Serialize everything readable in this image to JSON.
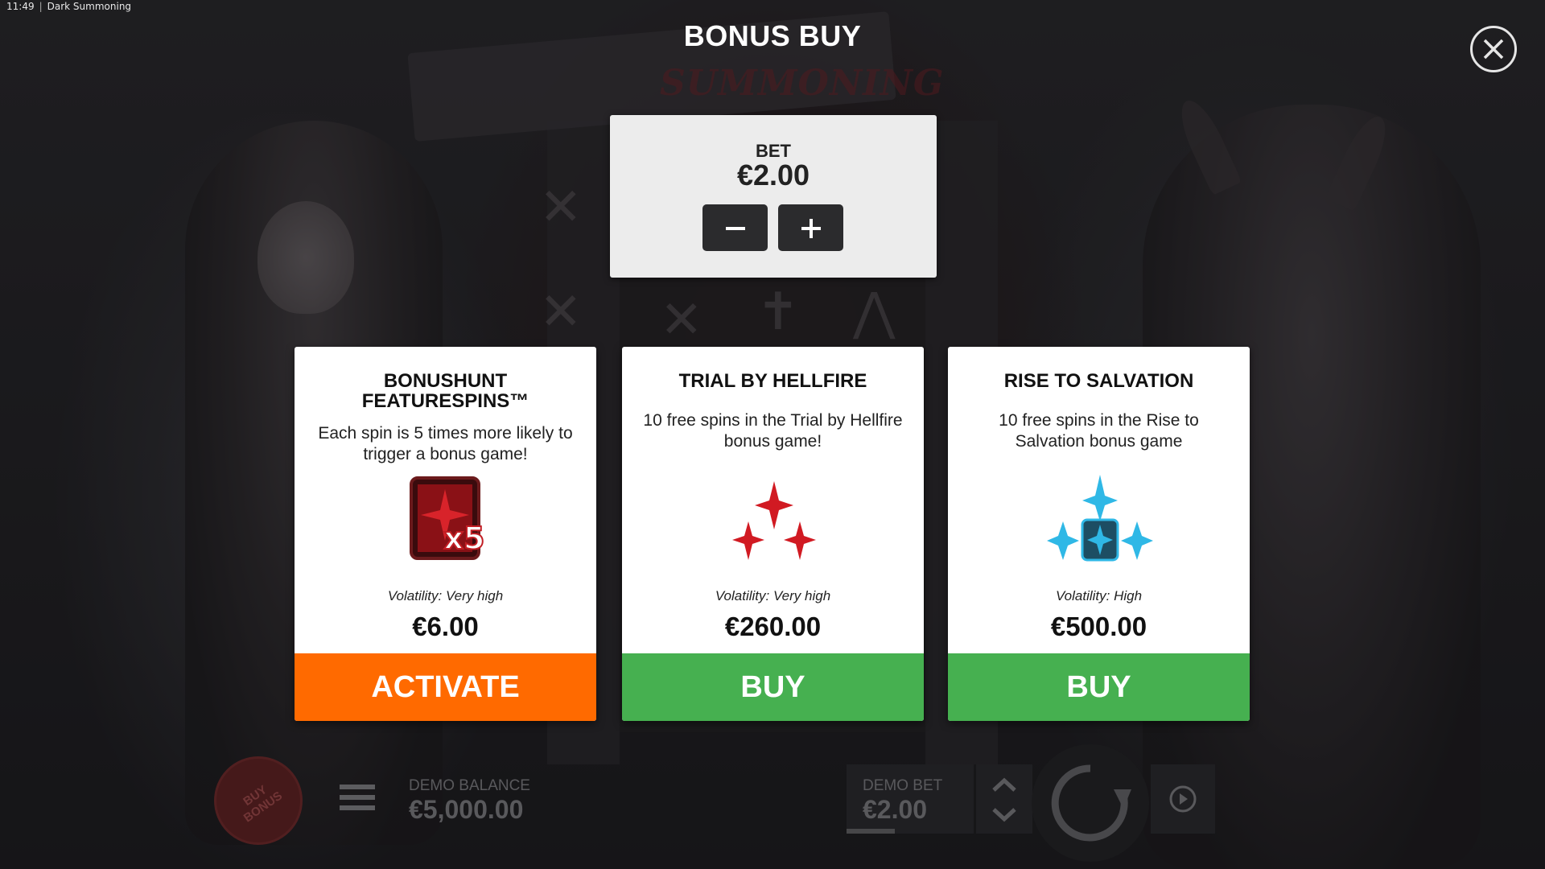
{
  "system": {
    "time": "11:49",
    "app_title": "Dark Summoning"
  },
  "background": {
    "logo_text": "SUMMONING"
  },
  "modal": {
    "title": "BONUS BUY",
    "close_icon": "close-icon"
  },
  "bet": {
    "label": "BET",
    "value": "€2.00",
    "decrease_icon": "minus-icon",
    "increase_icon": "plus-icon"
  },
  "cards": [
    {
      "title": "BONUSHUNT FEATURESPINS™",
      "description": "Each spin is 5 times more likely to trigger a bonus game!",
      "icon": "x5-multiplier-icon",
      "icon_text": "x5",
      "volatility": "Volatility: Very high",
      "price": "€6.00",
      "action": "ACTIVATE",
      "action_color": "#ff6a00"
    },
    {
      "title": "TRIAL BY HELLFIRE",
      "description": "10 free spins in the Trial by Hellfire bonus game!",
      "icon": "red-crosses-icon",
      "volatility": "Volatility: Very high",
      "price": "€260.00",
      "action": "BUY",
      "action_color": "#46b050"
    },
    {
      "title": "RISE TO SALVATION",
      "description": "10 free spins in the Rise to Salvation bonus game",
      "icon": "blue-crosses-icon",
      "volatility": "Volatility: High",
      "price": "€500.00",
      "action": "BUY",
      "action_color": "#46b050"
    }
  ],
  "hud": {
    "buy_bonus": "BUY BONUS",
    "balance_label": "DEMO BALANCE",
    "balance_value": "€5,000.00",
    "bet_label": "DEMO BET",
    "bet_value": "€2.00",
    "spin_icon": "spin-icon",
    "autoplay_icon": "autoplay-icon",
    "menu_icon": "hamburger-menu-icon"
  }
}
